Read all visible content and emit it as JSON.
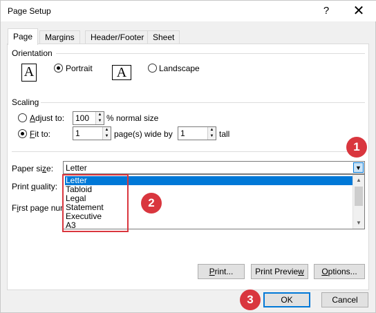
{
  "window": {
    "title": "Page Setup",
    "help_glyph": "?",
    "close_glyph": "✕"
  },
  "tabs": [
    {
      "label": "Page",
      "active": true
    },
    {
      "label": "Margins"
    },
    {
      "label": "Header/Footer"
    },
    {
      "label": "Sheet"
    }
  ],
  "orientation": {
    "label": "Orientation",
    "portrait_icon": "A",
    "landscape_icon": "A",
    "portrait_label": "Portrait",
    "landscape_label": "Landscape",
    "selected": "portrait"
  },
  "scaling": {
    "label": "Scaling",
    "adjust_to_label_a": "A",
    "adjust_to_label_rest": "djust to:",
    "adjust_value": "100",
    "adjust_suffix": "% normal size",
    "fit_to_label_a": "F",
    "fit_to_label_rest": "it to:",
    "wide_value": "1",
    "wide_suffix": "page(s) wide by",
    "tall_value": "1",
    "tall_suffix": "tall",
    "selected": "fit_to"
  },
  "paper": {
    "label_pre": "Paper si",
    "label_ul": "z",
    "label_post": "e:",
    "value": "Letter",
    "options": [
      "Letter",
      "Tabloid",
      "Legal",
      "Statement",
      "Executive",
      "A3"
    ],
    "selected_index": 0
  },
  "print_quality": {
    "label_pre": "Print ",
    "label_ul": "q",
    "label_post": "uality:"
  },
  "first_page": {
    "label_pre": "F",
    "label_ul": "i",
    "label_post": "rst page num"
  },
  "panel_buttons": {
    "print_pre": "",
    "print_ul": "P",
    "print_post": "rint...",
    "preview_pre": "Print Previe",
    "preview_ul": "w",
    "preview_post": "",
    "options_pre": "",
    "options_ul": "O",
    "options_post": "ptions..."
  },
  "footer": {
    "ok": "OK",
    "cancel": "Cancel"
  },
  "callouts": [
    "1",
    "2",
    "3"
  ],
  "colors": {
    "accent": "#0078d7",
    "callout": "#d9363e",
    "highlight_border": "#d9363e"
  }
}
